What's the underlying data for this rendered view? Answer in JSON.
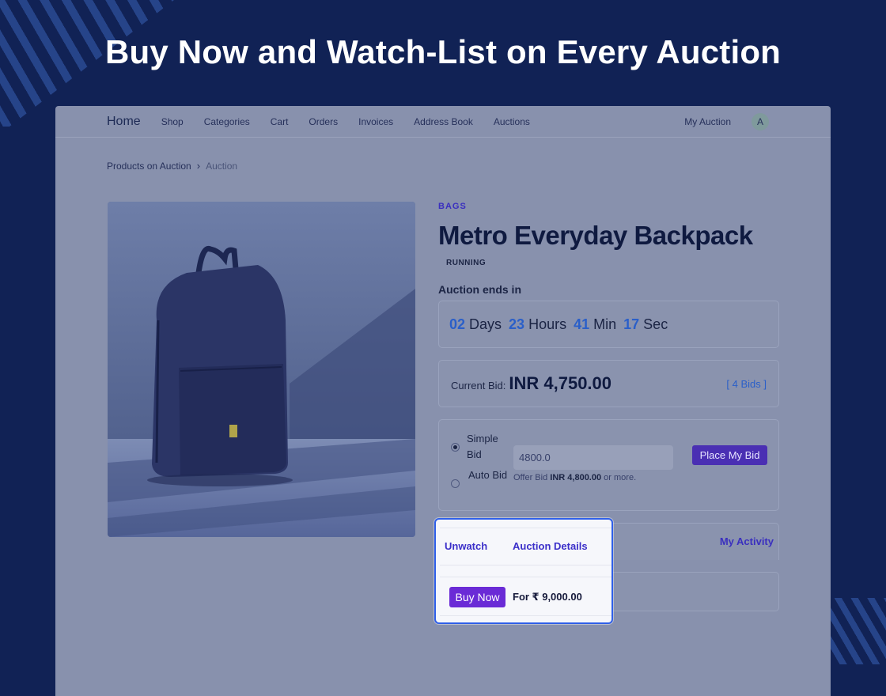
{
  "hero": {
    "title": "Buy Now and Watch-List on Every Auction"
  },
  "nav": {
    "home": "Home",
    "items": [
      "Shop",
      "Categories",
      "Cart",
      "Orders",
      "Invoices",
      "Address Book",
      "Auctions"
    ],
    "my_auction": "My Auction",
    "avatar_initial": "A"
  },
  "breadcrumb": {
    "parent": "Products on Auction",
    "separator": "›",
    "current": "Auction"
  },
  "product": {
    "category": "BAGS",
    "title": "Metro Everyday Backpack",
    "status": "RUNNING"
  },
  "countdown": {
    "label": "Auction ends in",
    "days": "02",
    "days_unit": "Days",
    "hours": "23",
    "hours_unit": "Hours",
    "min": "41",
    "min_unit": "Min",
    "sec": "17",
    "sec_unit": "Sec"
  },
  "bid": {
    "current_label": "Current Bid:",
    "current_amount": "INR 4,750.00",
    "bids_link": "[ 4 Bids ]"
  },
  "place_bid": {
    "simple_bid_label": "Simple Bid",
    "auto_bid_label": "Auto Bid",
    "input_value": "4800.0",
    "offer_prefix": "Offer Bid",
    "offer_amount": "INR 4,800.00",
    "offer_suffix": "or more.",
    "button_label": "Place My Bid"
  },
  "tabs": {
    "unwatch": "Unwatch",
    "auction_details": "Auction Details",
    "my_activity": "My Activity"
  },
  "buy_now": {
    "button_label": "Buy Now",
    "price_text": "For ₹ 9,000.00"
  },
  "colors": {
    "background": "#112255",
    "accent_purple": "#6a2bd6",
    "highlight_border": "#2f5fe8",
    "countdown_blue": "#2a5fc9"
  }
}
